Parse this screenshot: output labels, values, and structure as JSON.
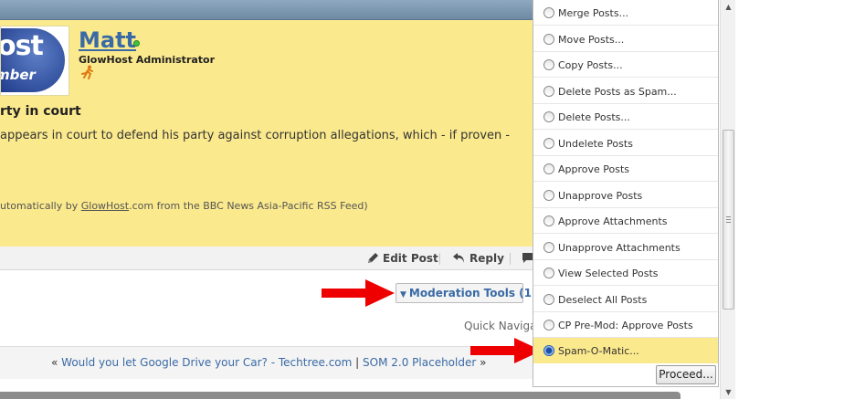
{
  "post": {
    "avatar_text_line1": "ost",
    "avatar_text_line2": "mber",
    "username": "Matt",
    "user_title": "GlowHost Administrator",
    "title": "rty in court",
    "body": "appears in court to defend his party against corruption allegations, which - if proven -",
    "footer_prefix": "utomatically by ",
    "footer_link": "GlowHost",
    "footer_suffix": ".com from the BBC News Asia-Pacific RSS Feed)"
  },
  "actions": {
    "edit_post": "Edit Post",
    "reply": "Reply"
  },
  "moderation": {
    "button_label": "Moderation Tools (1)",
    "menu_items": [
      {
        "label": "Merge Posts...",
        "checked": false
      },
      {
        "label": "Move Posts...",
        "checked": false
      },
      {
        "label": "Copy Posts...",
        "checked": false
      },
      {
        "label": "Delete Posts as Spam...",
        "checked": false
      },
      {
        "label": "Delete Posts...",
        "checked": false
      },
      {
        "label": "Undelete Posts",
        "checked": false
      },
      {
        "label": "Approve Posts",
        "checked": false
      },
      {
        "label": "Unapprove Posts",
        "checked": false
      },
      {
        "label": "Approve Attachments",
        "checked": false
      },
      {
        "label": "Unapprove Attachments",
        "checked": false
      },
      {
        "label": "View Selected Posts",
        "checked": false
      },
      {
        "label": "Deselect All Posts",
        "checked": false
      },
      {
        "label": "CP Pre-Mod: Approve Posts",
        "checked": false
      },
      {
        "label": "Spam-O-Matic...",
        "checked": true
      }
    ],
    "proceed_label": "Proceed..."
  },
  "quick_nav": "Quick Navigat",
  "thread_nav": {
    "prev_marker": "«",
    "prev_title": "Would you let Google Drive your Car? - Techtree.com",
    "divider": "|",
    "next_title": "SOM 2.0 Placeholder",
    "next_marker": "»"
  },
  "colors": {
    "post_background": "#fbe98d",
    "link_blue": "#3a6aa5",
    "arrow_red": "#ee0000"
  }
}
